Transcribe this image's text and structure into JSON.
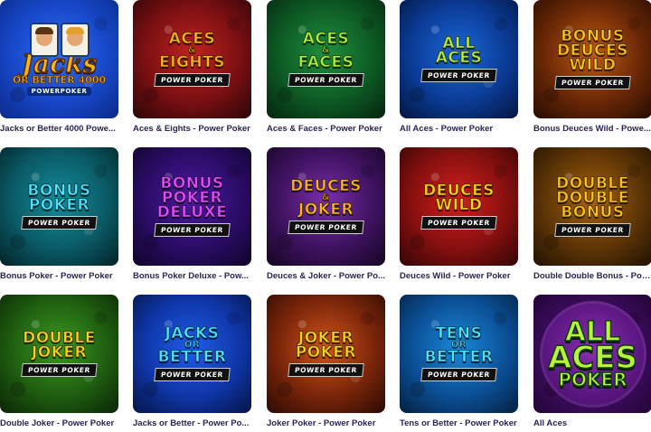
{
  "games": [
    {
      "caption": "Jacks or Better 4000 Powe...",
      "logo": [
        "Jacks",
        "OR BETTER 4000"
      ],
      "badge": "POWERPOKER",
      "style": "jacks"
    },
    {
      "caption": "Aces & Eights - Power Poker",
      "logo": [
        "ACES",
        "&",
        "EIGHTS"
      ],
      "badge": "POWER POKER",
      "style": "std"
    },
    {
      "caption": "Aces & Faces - Power Poker",
      "logo": [
        "ACES",
        "&",
        "FACES"
      ],
      "badge": "POWER POKER",
      "style": "std"
    },
    {
      "caption": "All Aces - Power Poker",
      "logo": [
        "ALL",
        "ACES"
      ],
      "badge": "POWER POKER",
      "style": "std"
    },
    {
      "caption": "Bonus Deuces Wild - Powe...",
      "logo": [
        "BONUS",
        "DEUCES",
        "WILD"
      ],
      "badge": "POWER POKER",
      "style": "std"
    },
    {
      "caption": "Bonus Poker - Power Poker",
      "logo": [
        "BONUS",
        "POKER"
      ],
      "badge": "POWER POKER",
      "style": "std"
    },
    {
      "caption": "Bonus Poker Deluxe - Pow...",
      "logo": [
        "BONUS",
        "POKER",
        "DELUXE"
      ],
      "badge": "POWER POKER",
      "style": "std"
    },
    {
      "caption": "Deuces & Joker - Power Po...",
      "logo": [
        "DEUCES",
        "&",
        "JOKER"
      ],
      "badge": "POWER POKER",
      "style": "std"
    },
    {
      "caption": "Deuces Wild - Power Poker",
      "logo": [
        "DEUCES",
        "WILD"
      ],
      "badge": "POWER POKER",
      "style": "std"
    },
    {
      "caption": "Double Double Bonus - Pow...",
      "logo": [
        "DOUBLE",
        "DOUBLE",
        "BONUS"
      ],
      "badge": "POWER POKER",
      "style": "std"
    },
    {
      "caption": "Double Joker - Power Poker",
      "logo": [
        "DOUBLE",
        "JOKER"
      ],
      "badge": "POWER POKER",
      "style": "std"
    },
    {
      "caption": "Jacks or Better - Power Po...",
      "logo": [
        "JACKS",
        "OR",
        "BETTER"
      ],
      "badge": "POWER POKER",
      "style": "std"
    },
    {
      "caption": "Joker Poker - Power Poker",
      "logo": [
        "JOKER",
        "POKER"
      ],
      "badge": "POWER POKER",
      "style": "std"
    },
    {
      "caption": "Tens or Better - Power Poker",
      "logo": [
        "TENS",
        "OR",
        "BETTER"
      ],
      "badge": "POWER POKER",
      "style": "std"
    },
    {
      "caption": "All Aces",
      "logo": [
        "ALL",
        "ACES",
        "POKER"
      ],
      "badge": "",
      "style": "allaces"
    }
  ],
  "colors": {
    "caption": "#2b2352",
    "tiles": [
      {
        "bg": "radial-gradient(circle at 50% 45%, #2f6df0 0%, #1747c8 55%, #0c2a8a 100%)",
        "text": "#f4b51d"
      },
      {
        "bg": "radial-gradient(circle at 50% 45%, #c0231f 0%, #7a0f12 55%, #2a0608 100%)",
        "text": "#ffb21a"
      },
      {
        "bg": "radial-gradient(circle at 50% 45%, #1f8f3c 0%, #0d5a24 55%, #05240f 100%)",
        "text": "#a8f23a"
      },
      {
        "bg": "radial-gradient(circle at 50% 45%, #1a68d8 0%, #0b3b96 55%, #04153f 100%)",
        "text": "#b8f23a"
      },
      {
        "bg": "radial-gradient(circle at 50% 45%, #c05a10 0%, #6b2806 55%, #250c02 100%)",
        "text": "#ffc21a"
      },
      {
        "bg": "radial-gradient(circle at 50% 45%, #138d9a 0%, #0a5a66 55%, #032227 100%)",
        "text": "#4fe3ff"
      },
      {
        "bg": "radial-gradient(circle at 50% 45%, #4d1aa0 0%, #2a0c66 55%, #0f0428 100%)",
        "text": "#e44bff"
      },
      {
        "bg": "radial-gradient(circle at 50% 45%, #7a2ea8 0%, #3e1260 55%, #140521 100%)",
        "text": "#ffb21a"
      },
      {
        "bg": "radial-gradient(circle at 50% 45%, #d21f1c 0%, #86100f 55%, #320505 100%)",
        "text": "#ffd21a"
      },
      {
        "bg": "radial-gradient(circle at 50% 45%, #a8620e 0%, #5e3506 55%, #201102 100%)",
        "text": "#ffc21a"
      },
      {
        "bg": "radial-gradient(circle at 50% 45%, #3a9a20 0%, #1f5e10 55%, #0a2405 100%)",
        "text": "#ffd21a"
      },
      {
        "bg": "radial-gradient(circle at 50% 45%, #1f5de8 0%, #0f36a8 55%, #051445 100%)",
        "text": "#4fe3ff"
      },
      {
        "bg": "radial-gradient(circle at 50% 45%, #d2541a 0%, #7a250a 55%, #2a0a02 100%)",
        "text": "#ffd21a"
      },
      {
        "bg": "radial-gradient(circle at 50% 45%, #1a8ad8 0%, #0b4f96 55%, #04203f 100%)",
        "text": "#4fe3ff"
      },
      {
        "bg": "radial-gradient(circle at 50% 50%, #6a2090 0%, #3a0b5a 60%, #220536 100%)",
        "text": "#b8f23a"
      }
    ]
  }
}
